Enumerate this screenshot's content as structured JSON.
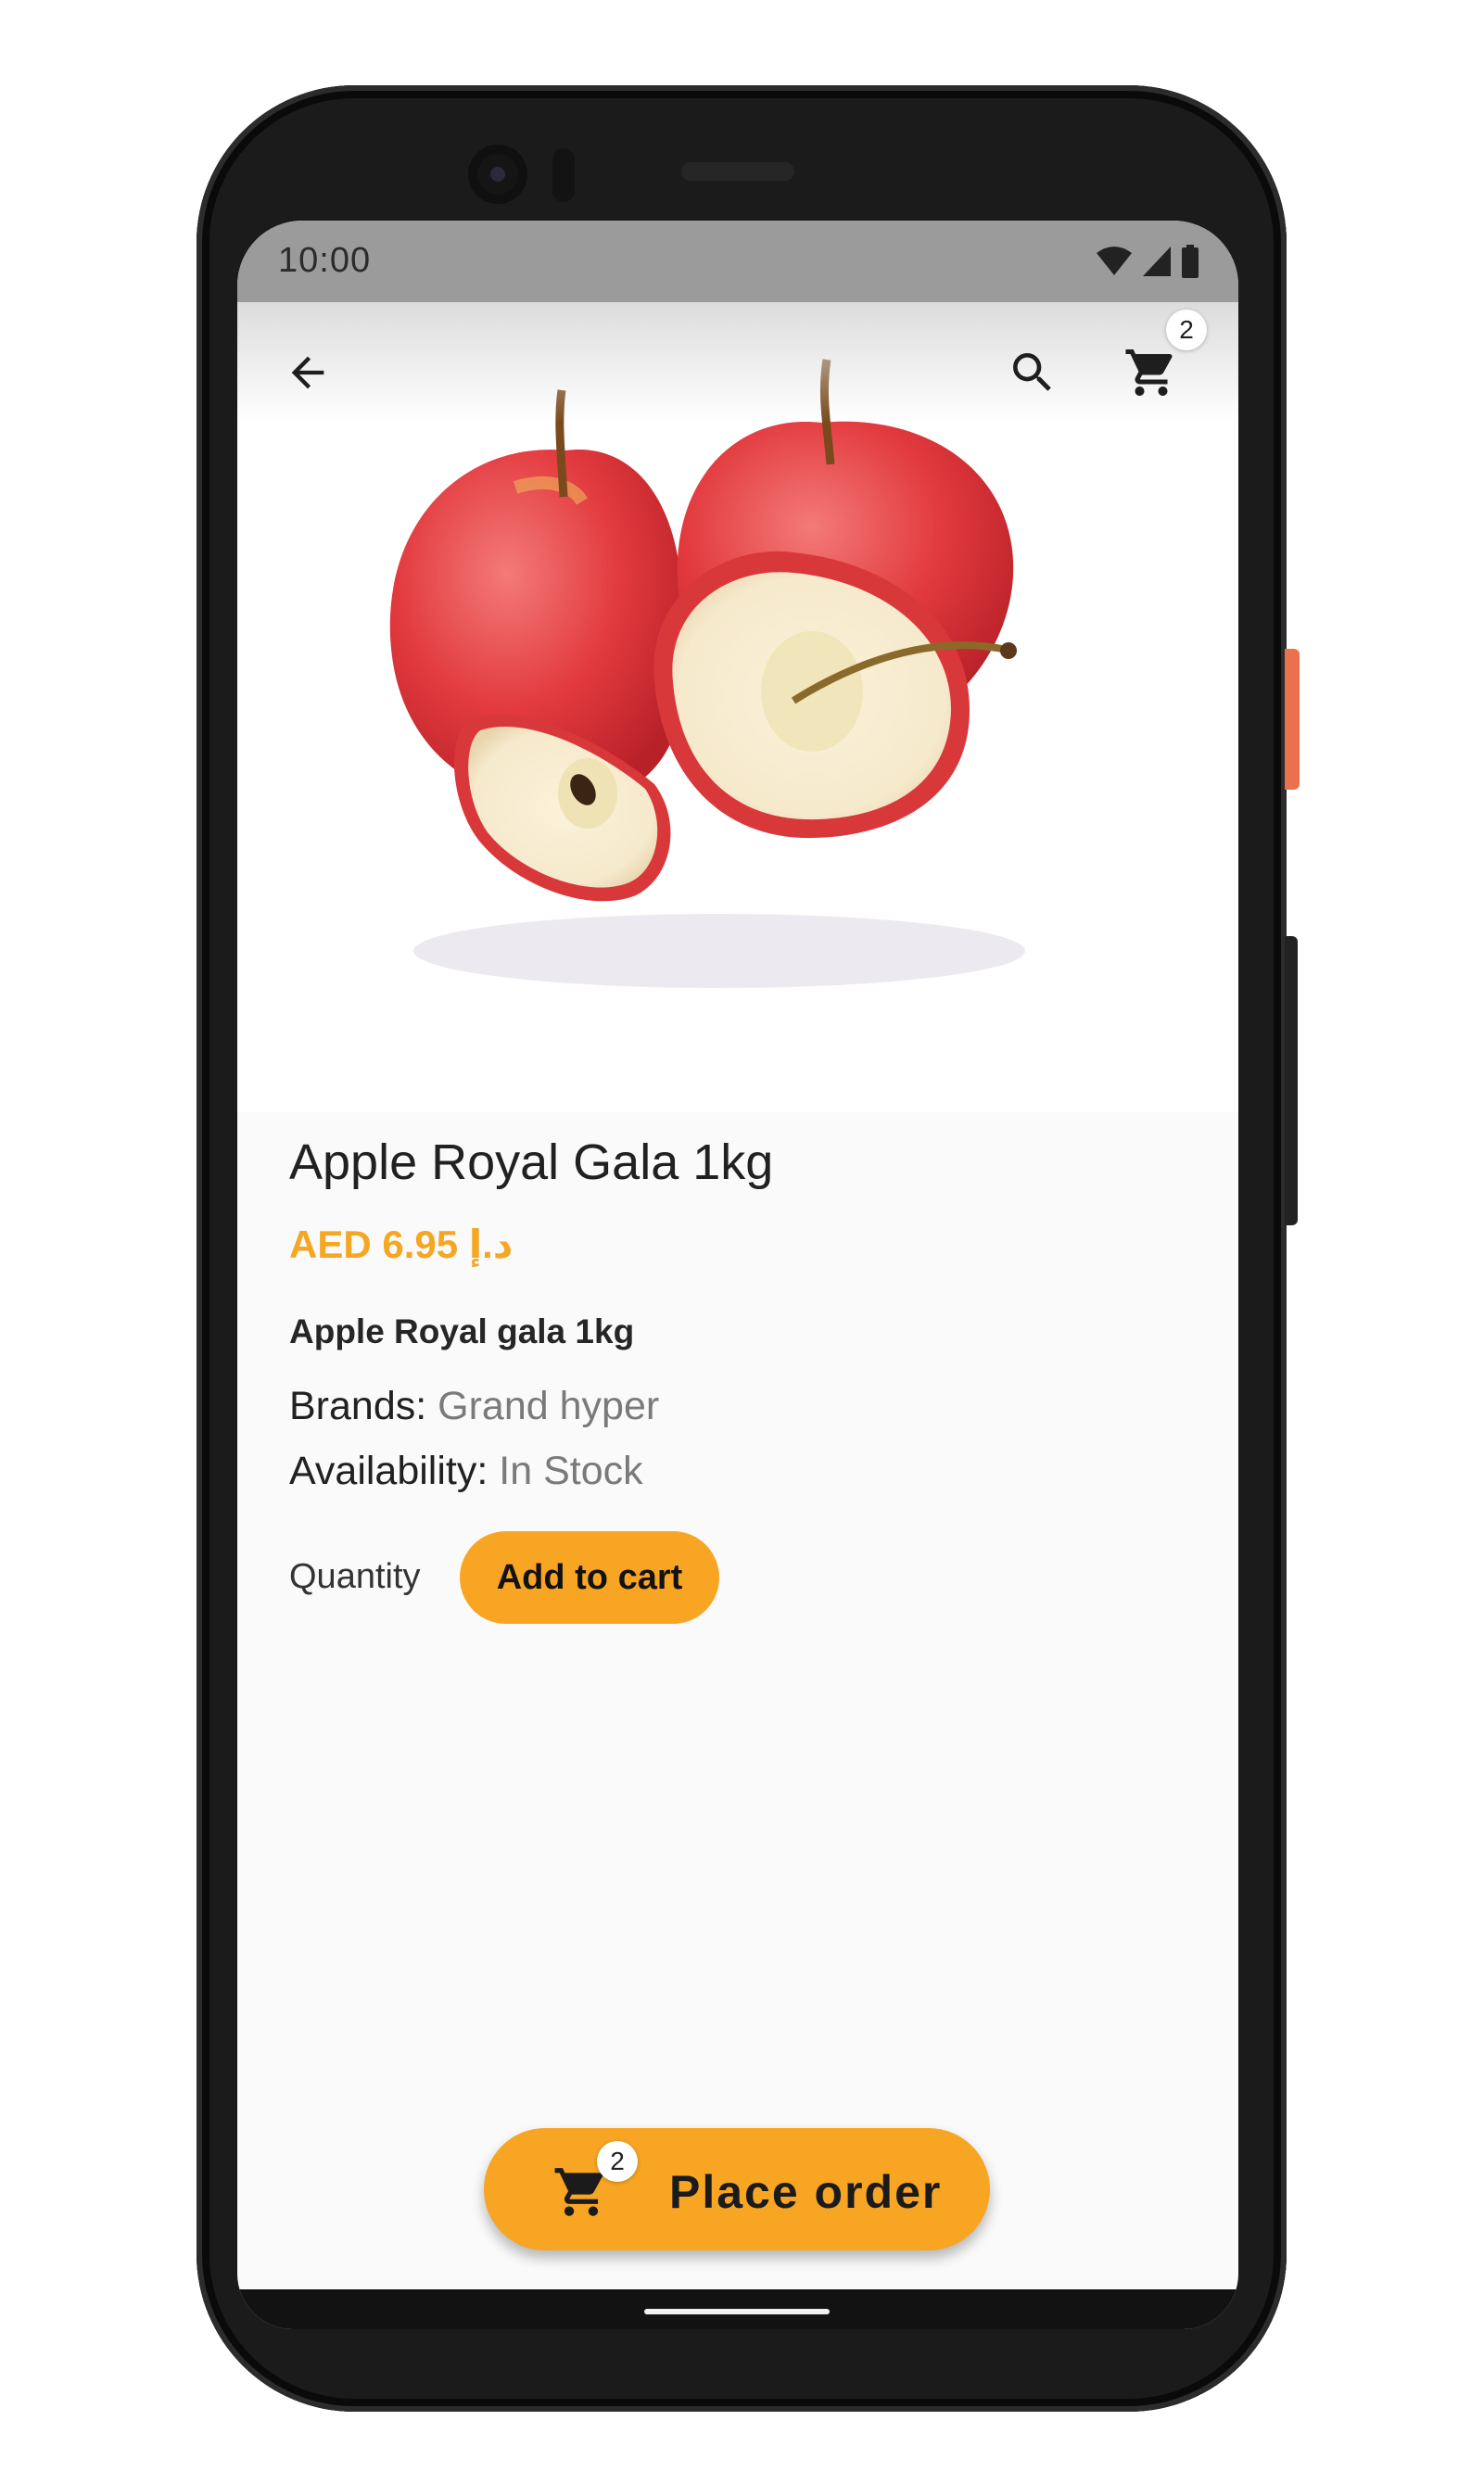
{
  "status_bar": {
    "time": "10:00",
    "icons": [
      "wifi-icon",
      "cell-signal-icon",
      "battery-icon"
    ]
  },
  "toolbar": {
    "back_icon": "arrow-back-icon",
    "search_icon": "search-icon",
    "cart_icon": "cart-icon",
    "cart_count": "2"
  },
  "product": {
    "image": "apples-photo",
    "title": "Apple Royal Gala 1kg",
    "price": "AED 6.95 د.إ",
    "description": "Apple Royal gala 1kg",
    "brand_label": "Brands:",
    "brand_value": "Grand hyper",
    "availability_label": "Availability:",
    "availability_value": "In Stock"
  },
  "purchase": {
    "quantity_label": "Quantity",
    "add_to_cart_label": "Add to cart"
  },
  "place_order": {
    "label": "Place order",
    "cart_count": "2"
  },
  "colors": {
    "accent": "#f8a524",
    "price": "#f5a623",
    "text": "#212121",
    "muted": "#7a7a7a"
  }
}
